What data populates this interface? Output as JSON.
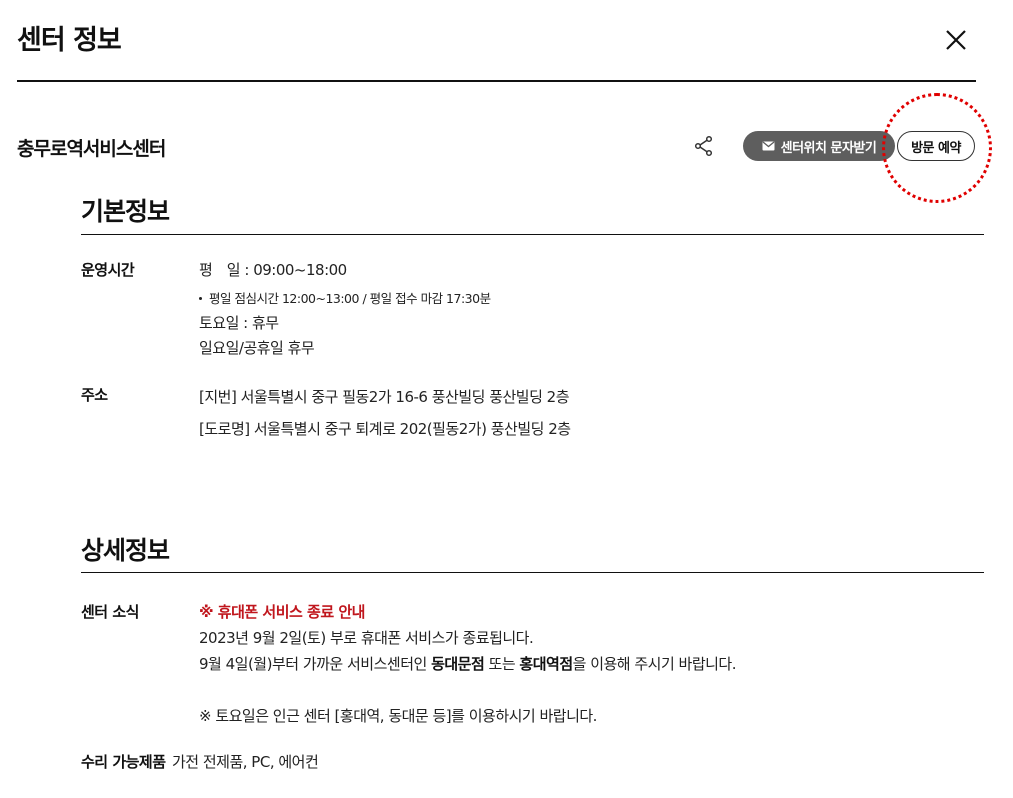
{
  "header": {
    "title": "센터 정보"
  },
  "center": {
    "name": "충무로역서비스센터",
    "sms_button": "센터위치 문자받기",
    "visit_button": "방문 예약"
  },
  "basic": {
    "title": "기본정보",
    "hours_label": "운영시간",
    "weekday": "평　일 : 09:00~18:00",
    "weekday_note": "평일 점심시간 12:00~13:00 / 평일 접수 마감 17:30분",
    "saturday": "토요일 : 휴무",
    "sunday": "일요일/공휴일 휴무",
    "address_label": "주소",
    "address_lot": "[지번] 서울특별시 중구 필동2가 16-6 풍산빌딩 풍산빌딩 2층",
    "address_road": "[도로명] 서울특별시 중구 퇴계로 202(필동2가) 풍산빌딩 2층"
  },
  "detail": {
    "title": "상세정보",
    "news_label": "센터 소식",
    "notice_title": "※ 휴대폰 서비스 종료 안내",
    "notice_line1": "2023년 9월 2일(토) 부로 휴대폰 서비스가 종료됩니다.",
    "notice_line2_a": "9월 4일(월)부터 가까운 서비스센터인 ",
    "notice_line2_b": "동대문점",
    "notice_line2_c": " 또는 ",
    "notice_line2_d": "홍대역점",
    "notice_line2_e": "을 이용해 주시기 바랍니다.",
    "notice_line3": "※ 토요일은 인근 센터 [홍대역, 동대문 등]를 이용하시기 바랍니다.",
    "repair_label": "수리 가능제품",
    "repair_value": "가전 전제품, PC, 에어컨"
  },
  "colors": {
    "notice_red": "#c0161d",
    "sms_button_bg": "#5e5e5e",
    "highlight_circle": "#e00000"
  }
}
